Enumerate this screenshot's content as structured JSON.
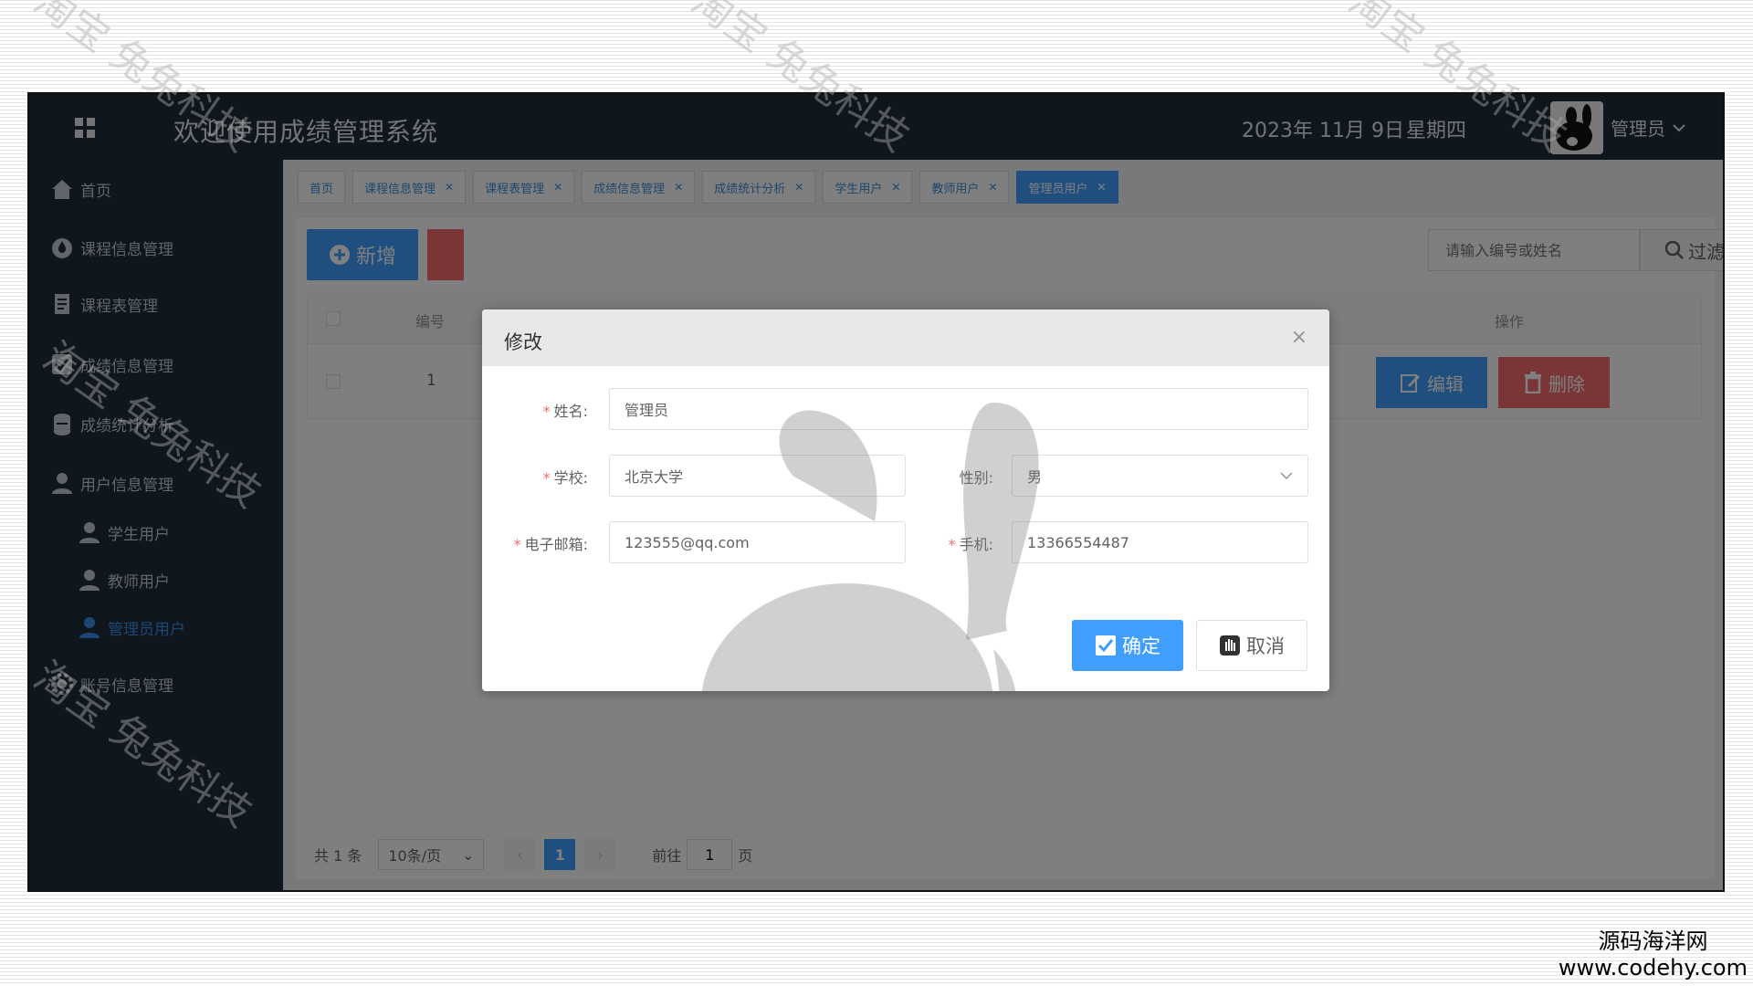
{
  "header": {
    "title": "欢迎使用成绩管理系统",
    "date": "2023年 11月 9日",
    "weekday": "星期四",
    "user": "管理员"
  },
  "sidebar": {
    "items": [
      {
        "label": "首页",
        "icon": "home-icon"
      },
      {
        "label": "课程信息管理",
        "icon": "drop-icon"
      },
      {
        "label": "课程表管理",
        "icon": "document-icon"
      },
      {
        "label": "成绩信息管理",
        "icon": "checkbox-icon"
      },
      {
        "label": "成绩统计分析",
        "icon": "stack-icon"
      },
      {
        "label": "用户信息管理",
        "icon": "user-icon"
      },
      {
        "label": "学生用户",
        "icon": "user-icon"
      },
      {
        "label": "教师用户",
        "icon": "user-icon"
      },
      {
        "label": "管理员用户",
        "icon": "user-icon",
        "active": true
      },
      {
        "label": "账号信息管理",
        "icon": "gear-icon"
      }
    ]
  },
  "tabs": [
    {
      "label": "首页",
      "closable": false
    },
    {
      "label": "课程信息管理",
      "closable": true
    },
    {
      "label": "课程表管理",
      "closable": true
    },
    {
      "label": "成绩信息管理",
      "closable": true
    },
    {
      "label": "成绩统计分析",
      "closable": true
    },
    {
      "label": "学生用户",
      "closable": true
    },
    {
      "label": "教师用户",
      "closable": true
    },
    {
      "label": "管理员用户",
      "closable": true,
      "active": true
    }
  ],
  "toolbar": {
    "add_label": "新增",
    "search_placeholder": "请输入编号或姓名",
    "filter_label": "过滤"
  },
  "table": {
    "col_id": "编号",
    "col_ops": "操作",
    "rows": [
      {
        "id": "1",
        "edit_label": "编辑",
        "delete_label": "删除"
      }
    ]
  },
  "pagination": {
    "total": "共 1 条",
    "page_size": "10条/页",
    "current": "1",
    "goto_label": "前往",
    "goto_value": "1",
    "page_suffix": "页"
  },
  "dialog": {
    "title": "修改",
    "close": "×",
    "fields": {
      "name_label": "姓名:",
      "name_value": "管理员",
      "school_label": "学校:",
      "school_value": "北京大学",
      "gender_label": "性别:",
      "gender_value": "男",
      "email_label": "电子邮箱:",
      "email_value": "123555@qq.com",
      "phone_label": "手机:",
      "phone_value": "13366554487"
    },
    "ok_label": "确定",
    "cancel_label": "取消"
  },
  "watermark": {
    "text": "淘宝 兔兔科技"
  },
  "source": {
    "line1": "源码海洋网",
    "line2": "www.codehy.com"
  },
  "colors": {
    "primary": "#409eff",
    "danger": "#f56c6c",
    "sidebar_bg": "#1f2d3d"
  }
}
